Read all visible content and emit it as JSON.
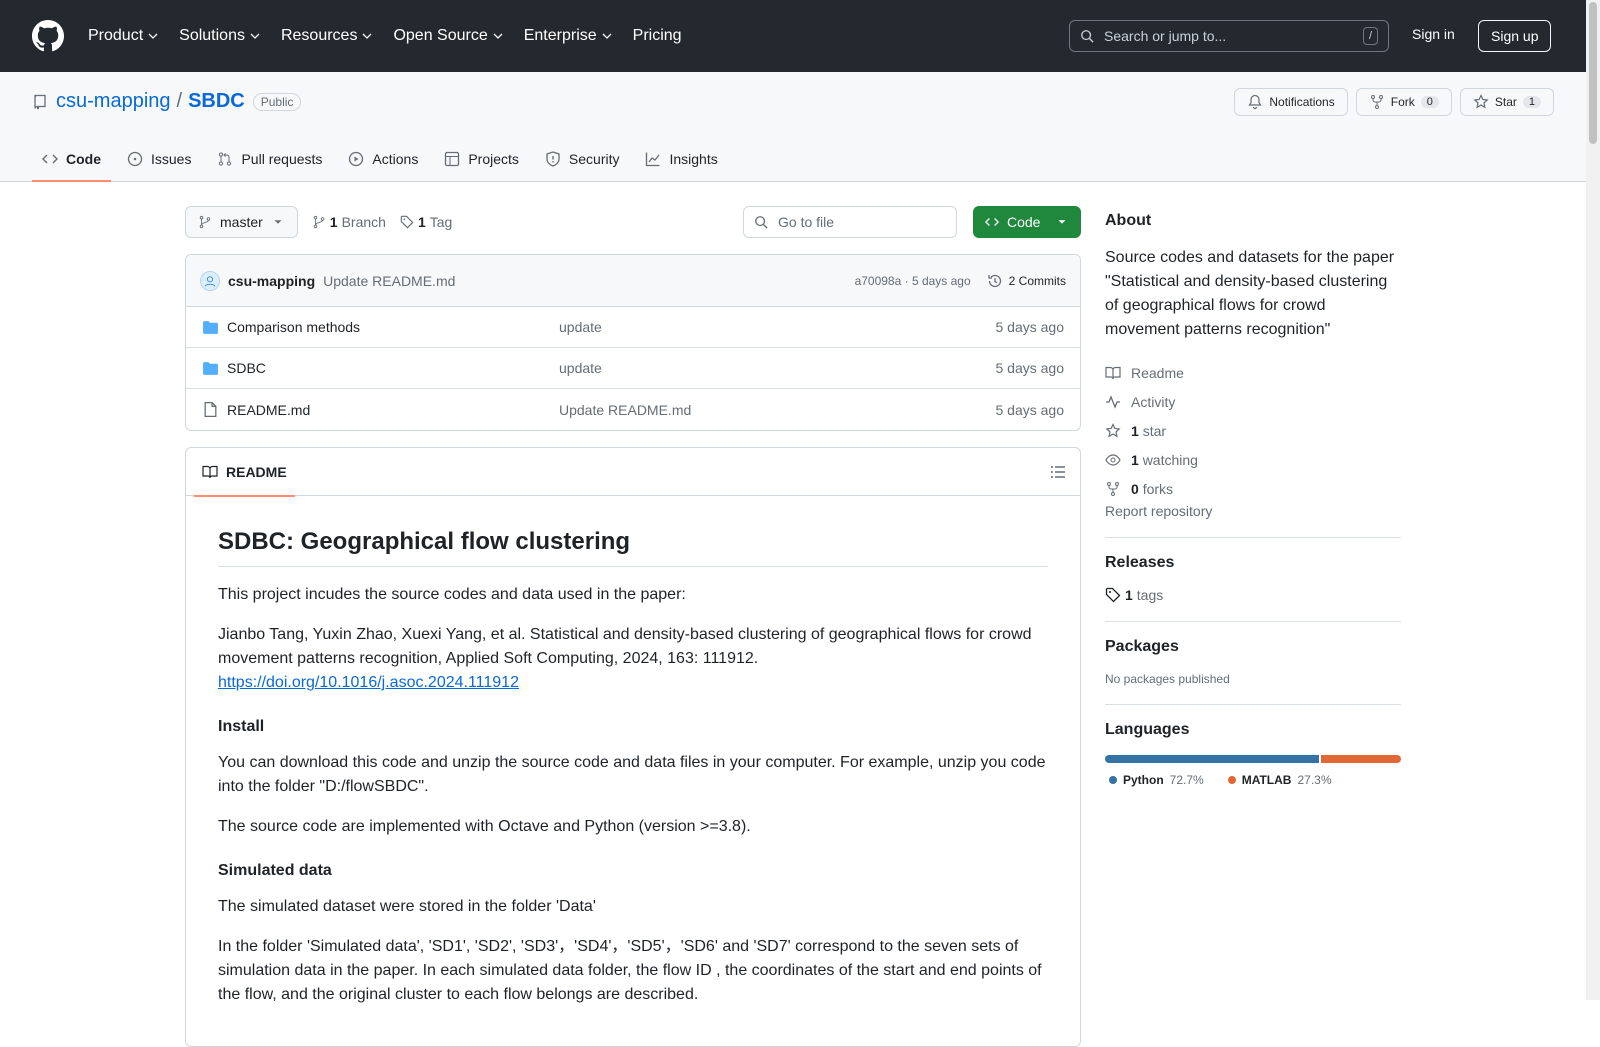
{
  "header": {
    "nav": [
      "Product",
      "Solutions",
      "Resources",
      "Open Source",
      "Enterprise",
      "Pricing"
    ],
    "search_placeholder": "Search or jump to...",
    "search_shortcut": "/",
    "signin": "Sign in",
    "signup": "Sign up"
  },
  "repo": {
    "owner": "csu-mapping",
    "separator": "/",
    "name": "SBDC",
    "visibility": "Public",
    "notifications_label": "Notifications",
    "fork_label": "Fork",
    "fork_count": "0",
    "star_label": "Star",
    "star_count": "1"
  },
  "tabs": [
    {
      "label": "Code",
      "icon": "code-icon",
      "active": true
    },
    {
      "label": "Issues",
      "icon": "issue-icon"
    },
    {
      "label": "Pull requests",
      "icon": "pull-request-icon"
    },
    {
      "label": "Actions",
      "icon": "play-icon"
    },
    {
      "label": "Projects",
      "icon": "table-icon"
    },
    {
      "label": "Security",
      "icon": "shield-icon"
    },
    {
      "label": "Insights",
      "icon": "graph-icon"
    }
  ],
  "toolbar": {
    "branch": "master",
    "branch_count": "1",
    "branch_label": "Branch",
    "tag_count": "1",
    "tag_label": "Tag",
    "gofile_placeholder": "Go to file",
    "code_button": "Code"
  },
  "commit": {
    "author": "csu-mapping",
    "message": "Update README.md",
    "hash_time": "a70098a · 5 days ago",
    "commits": "2 Commits"
  },
  "files": [
    {
      "name": "Comparison methods",
      "type": "folder",
      "message": "update",
      "date": "5 days ago"
    },
    {
      "name": "SDBC",
      "type": "folder",
      "message": "update",
      "date": "5 days ago"
    },
    {
      "name": "README.md",
      "type": "file",
      "message": "Update README.md",
      "date": "5 days ago"
    }
  ],
  "readme": {
    "tab": "README",
    "title": "SDBC: Geographical flow clustering",
    "p1": "This project incudes the source codes and data used in the paper:",
    "p2": "Jianbo Tang, Yuxin Zhao, Xuexi Yang, et al. Statistical and density-based clustering of geographical flows for crowd movement patterns recognition, Applied Soft Computing, 2024, 163: 111912.",
    "doi": "https://doi.org/10.1016/j.asoc.2024.111912",
    "h_install": "Install",
    "p3": "You can download this code and unzip the source code and data files in your computer. For example, unzip you code into the folder \"D:/flowSBDC\".",
    "p4": "The source code are implemented with Octave and Python (version >=3.8).",
    "h_sim": "Simulated data",
    "p5": "The simulated dataset were stored in the folder 'Data'",
    "p6": "In the folder 'Simulated data', 'SD1', 'SD2', 'SD3'，'SD4'，'SD5'，'SD6' and 'SD7' correspond to the seven sets of simulation data in the paper. In each simulated data folder, the flow ID , the coordinates of the start and end points of the flow, and the original cluster to each flow belongs are described."
  },
  "sidebar": {
    "about_title": "About",
    "about_text": "Source codes and datasets for the paper \"Statistical and density-based clustering of geographical flows for crowd movement patterns recognition\"",
    "readme": "Readme",
    "activity": "Activity",
    "stars_count": "1",
    "stars_label": "star",
    "watching_count": "1",
    "watching_label": "watching",
    "forks_count": "0",
    "forks_label": "forks",
    "report": "Report repository",
    "releases_title": "Releases",
    "tags_count": "1",
    "tags_label": "tags",
    "packages_title": "Packages",
    "packages_text": "No packages published",
    "languages_title": "Languages",
    "languages": [
      {
        "name": "Python",
        "percent": "72.7%",
        "value": 72.7,
        "color": "#3572A5"
      },
      {
        "name": "MATLAB",
        "percent": "27.3%",
        "value": 27.3,
        "color": "#e16737"
      }
    ]
  }
}
